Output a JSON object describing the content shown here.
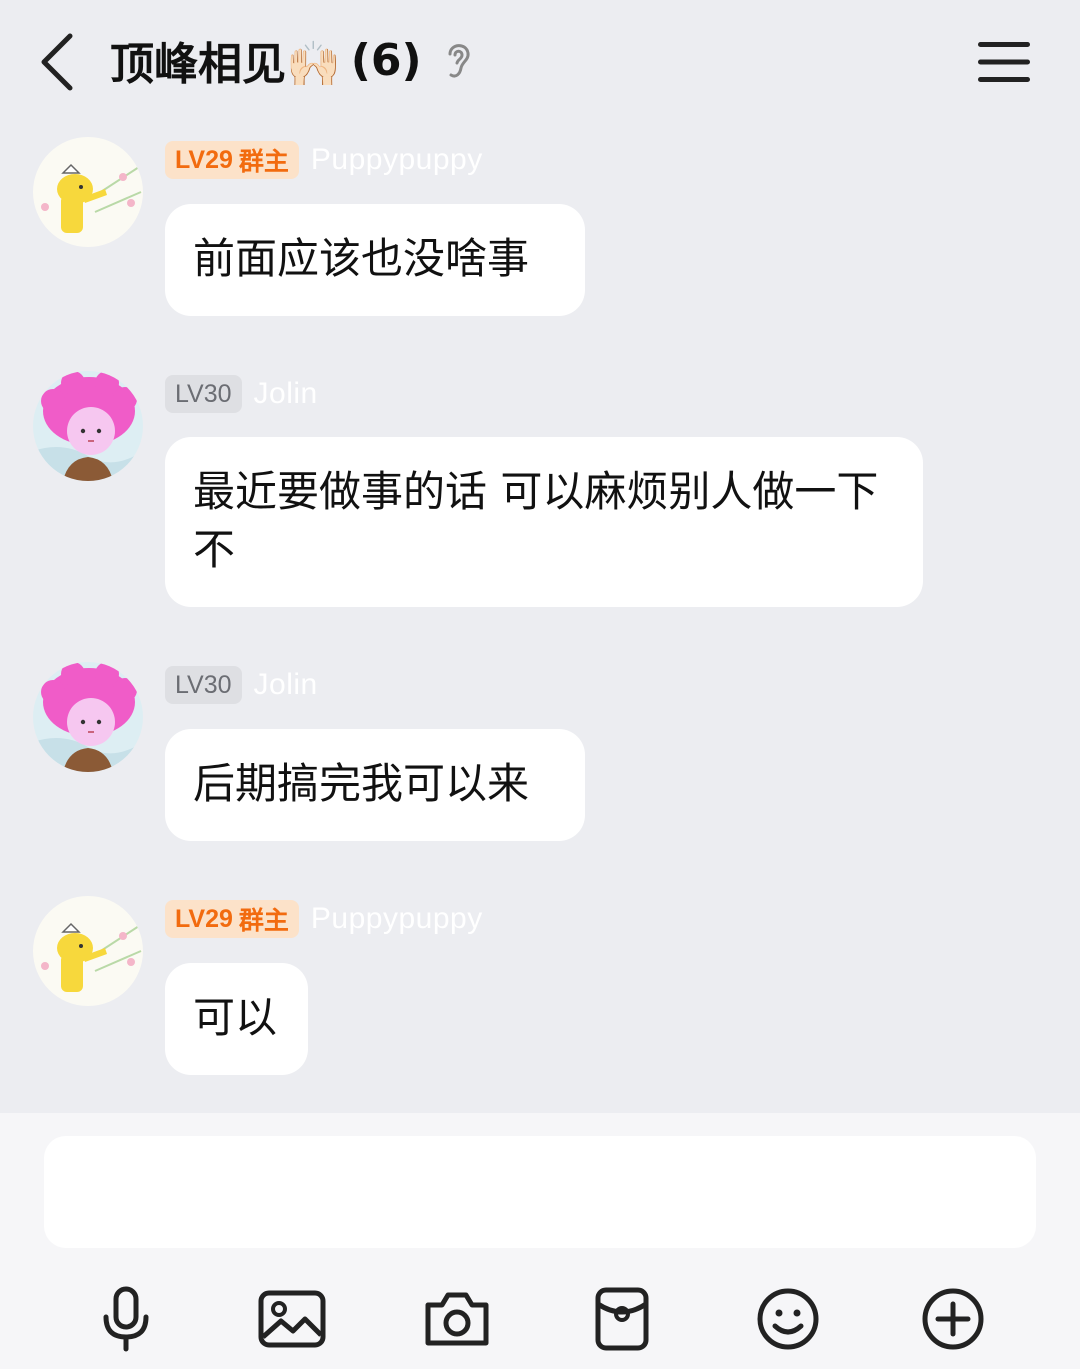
{
  "header": {
    "title": "顶峰相见🙌🏻",
    "member_count": "(6)",
    "icons": {
      "back": "back-chevron-icon",
      "ear": "ear-icon",
      "menu": "hamburger-menu-icon"
    }
  },
  "messages": [
    {
      "level": "LV29",
      "role": "群主",
      "name": "Puppypuppy",
      "avatar": "yellow-dog-avatar",
      "text": "前面应该也没啥事"
    },
    {
      "level": "LV30",
      "role": "",
      "name": "Jolin",
      "avatar": "pink-hair-girl-avatar",
      "text": "最近要做事的话 可以麻烦别人做一下不"
    },
    {
      "level": "LV30",
      "role": "",
      "name": "Jolin",
      "avatar": "pink-hair-girl-avatar",
      "text": "后期搞完我可以来"
    },
    {
      "level": "LV29",
      "role": "群主",
      "name": "Puppypuppy",
      "avatar": "yellow-dog-avatar",
      "text": "可以"
    }
  ],
  "input": {
    "value": "",
    "placeholder": ""
  },
  "toolbar": [
    "microphone-icon",
    "image-icon",
    "camera-icon",
    "red-packet-icon",
    "emoji-icon",
    "plus-icon"
  ],
  "colors": {
    "background": "#ECEDF1",
    "owner_badge_bg": "#FCE2C9",
    "owner_badge_text": "#F26B0F",
    "member_badge_bg": "#DEDFE3",
    "bubble": "#FFFFFF"
  }
}
